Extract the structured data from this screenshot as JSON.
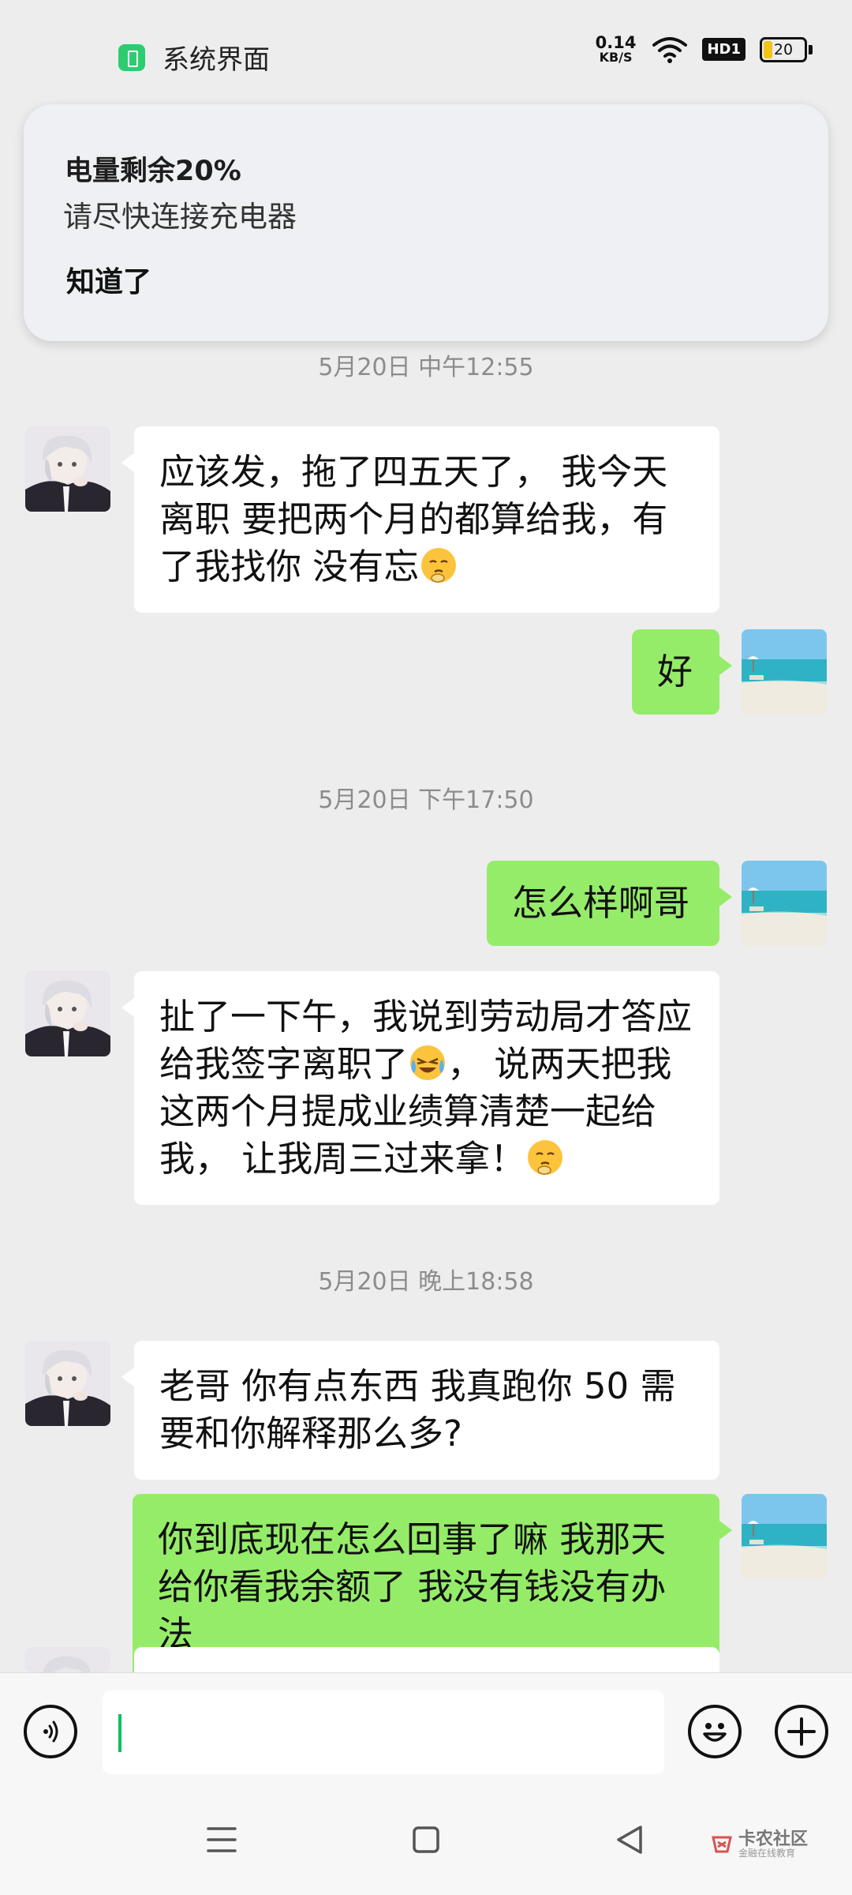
{
  "status_bar": {
    "app_name": "系统界面",
    "net_speed_value": "0.14",
    "net_speed_unit": "KB/S",
    "hd_badge": "HD1",
    "battery_percent": "20",
    "battery_level": 0.2
  },
  "notification": {
    "title": "电量剩余20%",
    "body": "请尽快连接充电器",
    "action_label": "知道了"
  },
  "timestamps": [
    "5月20日 中午12:55",
    "5月20日 下午17:50",
    "5月20日 晚上18:58"
  ],
  "messages": [
    {
      "direction": "in",
      "text": "应该发，拖了四五天了，  我今天离职  要把两个月的都算给我，有了我找你  没有忘",
      "emoji": "thinking-sad-emoji"
    },
    {
      "direction": "out",
      "text": "好"
    },
    {
      "direction": "out",
      "text": "怎么样啊哥"
    },
    {
      "direction": "in",
      "text_1": "扯了一下午，我说到劳动局才答应给我签字离职了",
      "emoji_1": "crying-laughing-emoji",
      "text_2": "，  说两天把我这两个月提成业绩算清楚一起给我，  让我周三过来拿！",
      "emoji_2": "thinking-sad-emoji"
    },
    {
      "direction": "in",
      "text": "老哥 你有点东西  我真跑你 50  需要和你解释那么多?"
    },
    {
      "direction": "out",
      "text": "你到底现在怎么回事了嘛 我那天给你看我余额了 我没有钱没有办法"
    }
  ],
  "watermark": {
    "line1": "卡农社区",
    "line2": "金融在线教育"
  },
  "colors": {
    "background": "#ededed",
    "bubble_out": "#95ec69",
    "bubble_in": "#ffffff",
    "caret": "#07c160"
  }
}
